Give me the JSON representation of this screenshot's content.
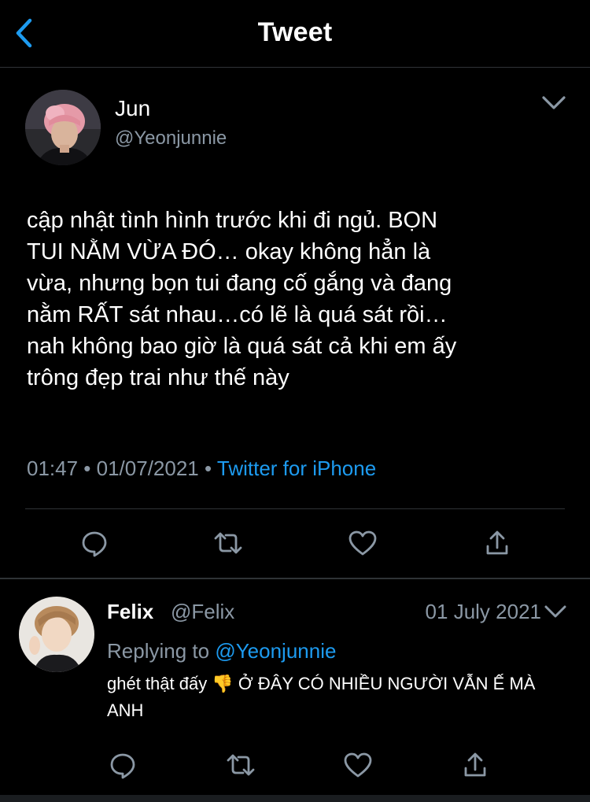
{
  "header": {
    "title": "Tweet",
    "back_icon": "chevron-left-icon"
  },
  "colors": {
    "background": "#000000",
    "accent": "#1d9bf0",
    "secondary_text": "#8b98a5",
    "divider": "#2f3336"
  },
  "main_tweet": {
    "author_name": "Jun",
    "author_handle": "@Yeonjunnie",
    "text": "cập nhật tình hình trước khi đi ngủ. BỌN\nTUI NẰM VỪA ĐÓ… okay không hẳn là\nvừa, nhưng bọn tui đang cố gắng và đang\nnằm RẤT sát nhau…có lẽ là quá sát rồi…\nnah không bao giờ là quá sát cả khi em ấy\ntrông đẹp trai như thế này",
    "time": "01:47",
    "sep1": " • ",
    "date": "01/07/2021",
    "sep2": " • ",
    "source": "Twitter for iPhone",
    "actions": [
      "reply-icon",
      "retweet-icon",
      "like-icon",
      "share-icon"
    ]
  },
  "reply": {
    "author_name": "Felix",
    "author_handle": "@Felix",
    "date": "01 July 2021",
    "replying_label": "Replying to ",
    "replying_mention": "@Yeonjunnie",
    "text_before_emoji": "ghét thật đấy ",
    "emoji": "👎",
    "text_after_emoji": " Ở ĐÂY CÓ NHIỀU NGƯỜI VẪN Ế MÀ ANH",
    "actions": [
      "reply-icon",
      "retweet-icon",
      "like-icon",
      "share-icon"
    ]
  }
}
